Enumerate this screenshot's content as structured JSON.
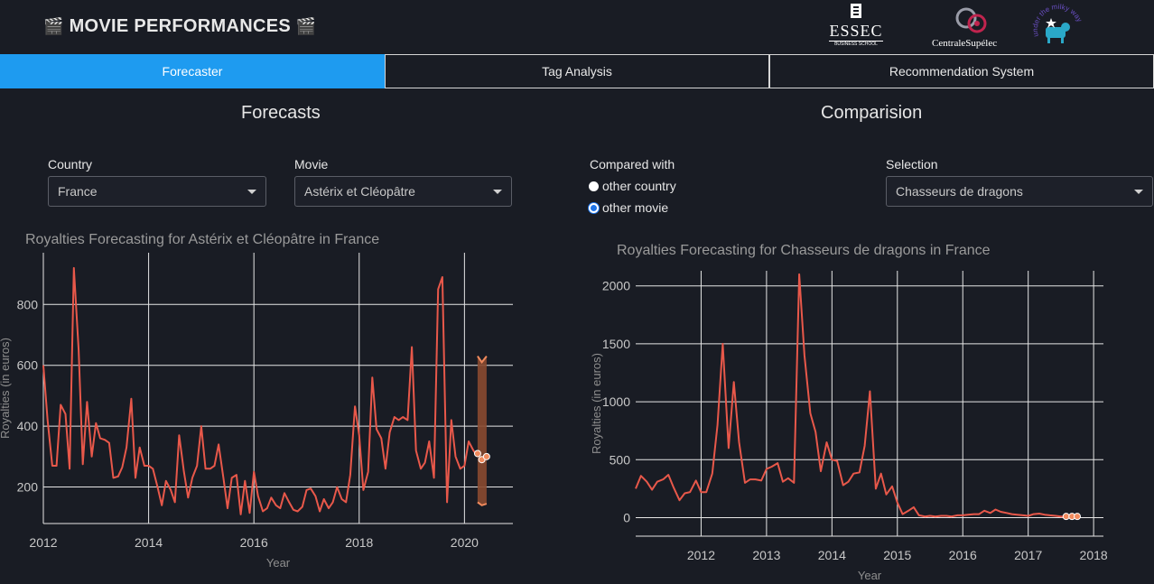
{
  "header": {
    "title": "MOVIE PERFORMANCES",
    "clapper": "🎬",
    "logos": {
      "essec": "ESSEC",
      "essec_sub": "BUSINESS SCHOOL",
      "centrale": "CentraleSupélec",
      "milky": "under the milky way"
    }
  },
  "tabs": [
    {
      "label": "Forecaster",
      "active": true
    },
    {
      "label": "Tag Analysis",
      "active": false
    },
    {
      "label": "Recommendation System",
      "active": false
    }
  ],
  "forecasts": {
    "title": "Forecasts",
    "country_label": "Country",
    "country_value": "France",
    "movie_label": "Movie",
    "movie_value": "Astérix et Cléopâtre"
  },
  "comparison": {
    "title": "Comparision",
    "compared_label": "Compared with",
    "options": [
      {
        "label": "other country",
        "checked": false
      },
      {
        "label": "other movie",
        "checked": true
      }
    ],
    "selection_label": "Selection",
    "selection_value": "Chasseurs de dragons"
  },
  "colors": {
    "accent": "#1e9bf0",
    "line": "#e8584a",
    "forecast": "#f08a5d",
    "band": "#8a4a30",
    "background": "#191c24"
  },
  "chart_data": [
    {
      "type": "line",
      "title": "Royalties Forecasting for Astérix et Cléopâtre in France",
      "xlabel": "Year",
      "ylabel": "Royalties (in euros)",
      "xlim": [
        2012,
        2020.92
      ],
      "ylim": [
        80,
        970
      ],
      "x_ticks": [
        2012,
        2014,
        2016,
        2018,
        2020
      ],
      "y_ticks": [
        200,
        400,
        600,
        800
      ],
      "grid": true,
      "series": [
        {
          "x": [
            2012.0,
            2012.08,
            2012.17,
            2012.25,
            2012.33,
            2012.42,
            2012.5,
            2012.58,
            2012.67,
            2012.75,
            2012.83,
            2012.92,
            2013.0,
            2013.08,
            2013.17,
            2013.25,
            2013.33,
            2013.42,
            2013.5,
            2013.58,
            2013.67,
            2013.75,
            2013.83,
            2013.92,
            2014.0,
            2014.08,
            2014.17,
            2014.25,
            2014.33,
            2014.42,
            2014.5,
            2014.58,
            2014.67,
            2014.75,
            2014.83,
            2014.92,
            2015.0,
            2015.08,
            2015.17,
            2015.25,
            2015.33,
            2015.42,
            2015.5,
            2015.58,
            2015.67,
            2015.75,
            2015.83,
            2015.92,
            2016.0,
            2016.08,
            2016.17,
            2016.25,
            2016.33,
            2016.42,
            2016.5,
            2016.58,
            2016.67,
            2016.75,
            2016.83,
            2016.92,
            2017.0,
            2017.08,
            2017.17,
            2017.25,
            2017.33,
            2017.42,
            2017.5,
            2017.58,
            2017.67,
            2017.75,
            2017.83,
            2017.92,
            2018.0,
            2018.08,
            2018.17,
            2018.25,
            2018.33,
            2018.42,
            2018.5,
            2018.58,
            2018.67,
            2018.75,
            2018.83,
            2018.92,
            2019.0,
            2019.08,
            2019.17,
            2019.25,
            2019.33,
            2019.42,
            2019.5,
            2019.58,
            2019.67,
            2019.75,
            2019.83,
            2019.92,
            2020.0,
            2020.08,
            2020.17,
            2020.25
          ],
          "values": [
            600,
            420,
            270,
            270,
            470,
            440,
            260,
            920,
            650,
            275,
            480,
            300,
            410,
            360,
            355,
            345,
            230,
            235,
            265,
            330,
            490,
            230,
            330,
            270,
            270,
            260,
            200,
            140,
            220,
            190,
            150,
            370,
            250,
            165,
            230,
            270,
            400,
            260,
            260,
            270,
            340,
            230,
            130,
            230,
            240,
            110,
            220,
            115,
            250,
            170,
            120,
            130,
            165,
            140,
            130,
            180,
            150,
            125,
            120,
            135,
            190,
            195,
            170,
            120,
            160,
            130,
            150,
            200,
            160,
            150,
            240,
            465,
            370,
            190,
            250,
            560,
            390,
            360,
            260,
            380,
            430,
            420,
            430,
            420,
            660,
            320,
            260,
            280,
            350,
            230,
            850,
            890,
            150,
            420,
            300,
            260,
            270,
            350,
            320,
            300
          ]
        },
        {
          "name": "forecast",
          "x": [
            2020.25,
            2020.33,
            2020.42
          ],
          "values": [
            310,
            290,
            300
          ],
          "upper": [
            630,
            610,
            630
          ],
          "lower": [
            150,
            140,
            145
          ]
        }
      ]
    },
    {
      "type": "line",
      "title": "Royalties Forecasting for Chasseurs de dragons in France",
      "xlabel": "Year",
      "ylabel": "Royalties (in euros)",
      "xlim": [
        2011.0,
        2018.15
      ],
      "ylim": [
        -160,
        2130
      ],
      "x_ticks": [
        2012,
        2013,
        2014,
        2015,
        2016,
        2017,
        2018
      ],
      "y_ticks": [
        0,
        500,
        1000,
        1500,
        2000
      ],
      "grid": true,
      "series": [
        {
          "x": [
            2011.0,
            2011.08,
            2011.17,
            2011.25,
            2011.33,
            2011.42,
            2011.5,
            2011.58,
            2011.67,
            2011.75,
            2011.83,
            2011.92,
            2012.0,
            2012.08,
            2012.17,
            2012.25,
            2012.33,
            2012.42,
            2012.5,
            2012.58,
            2012.67,
            2012.75,
            2012.83,
            2012.92,
            2013.0,
            2013.08,
            2013.17,
            2013.25,
            2013.33,
            2013.42,
            2013.5,
            2013.58,
            2013.67,
            2013.75,
            2013.83,
            2013.92,
            2014.0,
            2014.08,
            2014.17,
            2014.25,
            2014.33,
            2014.42,
            2014.5,
            2014.58,
            2014.67,
            2014.75,
            2014.83,
            2014.92,
            2015.0,
            2015.08,
            2015.17,
            2015.25,
            2015.33,
            2015.42,
            2015.5,
            2015.58,
            2015.67,
            2015.75,
            2015.83,
            2015.92,
            2016.0,
            2016.08,
            2016.17,
            2016.25,
            2016.33,
            2016.42,
            2016.5,
            2016.58,
            2016.67,
            2016.75,
            2016.83,
            2016.92,
            2017.0,
            2017.08,
            2017.17,
            2017.25,
            2017.33,
            2017.42,
            2017.5,
            2017.58
          ],
          "values": [
            250,
            360,
            310,
            240,
            310,
            330,
            370,
            260,
            150,
            210,
            220,
            320,
            220,
            220,
            380,
            800,
            1500,
            600,
            1170,
            650,
            300,
            330,
            330,
            320,
            420,
            440,
            470,
            310,
            340,
            300,
            2100,
            1400,
            900,
            740,
            400,
            650,
            500,
            490,
            280,
            310,
            380,
            390,
            620,
            1090,
            250,
            380,
            200,
            270,
            130,
            30,
            60,
            90,
            20,
            10,
            15,
            10,
            15,
            15,
            10,
            20,
            20,
            25,
            30,
            30,
            60,
            40,
            70,
            50,
            40,
            30,
            25,
            20,
            15,
            30,
            35,
            25,
            20,
            15,
            10,
            10
          ],
          "color": "line"
        },
        {
          "name": "forecast",
          "x": [
            2017.58,
            2017.67,
            2017.75
          ],
          "values": [
            10,
            10,
            10
          ]
        }
      ]
    }
  ]
}
